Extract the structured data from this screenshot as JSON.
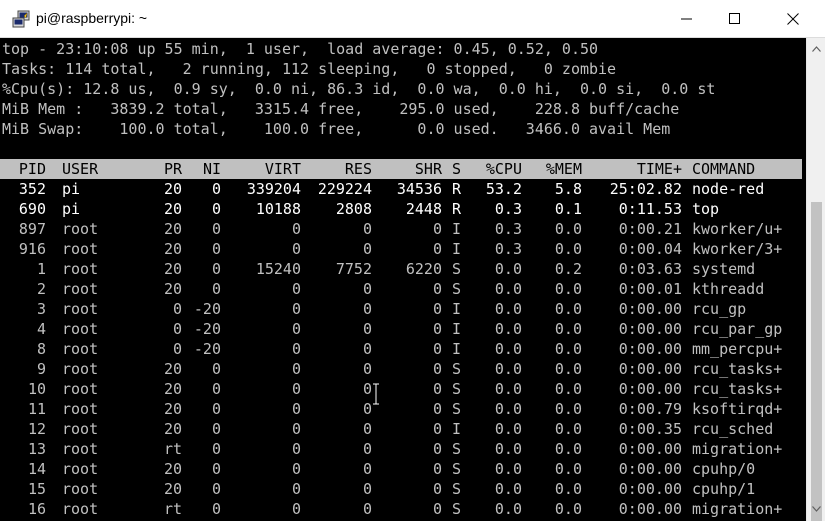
{
  "window": {
    "title": "pi@raspberrypi: ~",
    "app_icon": "putty-icon",
    "buttons": [
      "minimize-icon",
      "maximize-icon",
      "close-icon"
    ]
  },
  "summary": {
    "line1": "top - 23:10:08 up 55 min,  1 user,  load average: 0.45, 0.52, 0.50",
    "line2": "Tasks: 114 total,   2 running, 112 sleeping,   0 stopped,   0 zombie",
    "line3": "%Cpu(s): 12.8 us,  0.9 sy,  0.0 ni, 86.3 id,  0.0 wa,  0.0 hi,  0.0 si,  0.0 st",
    "line4": "MiB Mem :   3839.2 total,   3315.4 free,    295.0 used,    228.8 buff/cache",
    "line5": "MiB Swap:    100.0 total,    100.0 free,      0.0 used.   3466.0 avail Mem"
  },
  "columns": {
    "pid": "PID",
    "user": "USER",
    "pr": "PR",
    "ni": "NI",
    "virt": "VIRT",
    "res": "RES",
    "shr": "SHR",
    "s": "S",
    "cpu": "%CPU",
    "mem": "%MEM",
    "time": "TIME+",
    "command": "COMMAND"
  },
  "processes": [
    {
      "pid": "352",
      "user": "pi",
      "pr": "20",
      "ni": "0",
      "virt": "339204",
      "res": "229224",
      "shr": "34536",
      "s": "R",
      "cpu": "53.2",
      "mem": "5.8",
      "time": "25:02.82",
      "command": "node-red"
    },
    {
      "pid": "690",
      "user": "pi",
      "pr": "20",
      "ni": "0",
      "virt": "10188",
      "res": "2808",
      "shr": "2448",
      "s": "R",
      "cpu": "0.3",
      "mem": "0.1",
      "time": "0:11.53",
      "command": "top"
    },
    {
      "pid": "897",
      "user": "root",
      "pr": "20",
      "ni": "0",
      "virt": "0",
      "res": "0",
      "shr": "0",
      "s": "I",
      "cpu": "0.3",
      "mem": "0.0",
      "time": "0:00.21",
      "command": "kworker/u+"
    },
    {
      "pid": "916",
      "user": "root",
      "pr": "20",
      "ni": "0",
      "virt": "0",
      "res": "0",
      "shr": "0",
      "s": "I",
      "cpu": "0.3",
      "mem": "0.0",
      "time": "0:00.04",
      "command": "kworker/3+"
    },
    {
      "pid": "1",
      "user": "root",
      "pr": "20",
      "ni": "0",
      "virt": "15240",
      "res": "7752",
      "shr": "6220",
      "s": "S",
      "cpu": "0.0",
      "mem": "0.2",
      "time": "0:03.63",
      "command": "systemd"
    },
    {
      "pid": "2",
      "user": "root",
      "pr": "20",
      "ni": "0",
      "virt": "0",
      "res": "0",
      "shr": "0",
      "s": "S",
      "cpu": "0.0",
      "mem": "0.0",
      "time": "0:00.01",
      "command": "kthreadd"
    },
    {
      "pid": "3",
      "user": "root",
      "pr": "0",
      "ni": "-20",
      "virt": "0",
      "res": "0",
      "shr": "0",
      "s": "I",
      "cpu": "0.0",
      "mem": "0.0",
      "time": "0:00.00",
      "command": "rcu_gp"
    },
    {
      "pid": "4",
      "user": "root",
      "pr": "0",
      "ni": "-20",
      "virt": "0",
      "res": "0",
      "shr": "0",
      "s": "I",
      "cpu": "0.0",
      "mem": "0.0",
      "time": "0:00.00",
      "command": "rcu_par_gp"
    },
    {
      "pid": "8",
      "user": "root",
      "pr": "0",
      "ni": "-20",
      "virt": "0",
      "res": "0",
      "shr": "0",
      "s": "I",
      "cpu": "0.0",
      "mem": "0.0",
      "time": "0:00.00",
      "command": "mm_percpu+"
    },
    {
      "pid": "9",
      "user": "root",
      "pr": "20",
      "ni": "0",
      "virt": "0",
      "res": "0",
      "shr": "0",
      "s": "S",
      "cpu": "0.0",
      "mem": "0.0",
      "time": "0:00.00",
      "command": "rcu_tasks+"
    },
    {
      "pid": "10",
      "user": "root",
      "pr": "20",
      "ni": "0",
      "virt": "0",
      "res": "0",
      "shr": "0",
      "s": "S",
      "cpu": "0.0",
      "mem": "0.0",
      "time": "0:00.00",
      "command": "rcu_tasks+"
    },
    {
      "pid": "11",
      "user": "root",
      "pr": "20",
      "ni": "0",
      "virt": "0",
      "res": "0",
      "shr": "0",
      "s": "S",
      "cpu": "0.0",
      "mem": "0.0",
      "time": "0:00.79",
      "command": "ksoftirqd+"
    },
    {
      "pid": "12",
      "user": "root",
      "pr": "20",
      "ni": "0",
      "virt": "0",
      "res": "0",
      "shr": "0",
      "s": "I",
      "cpu": "0.0",
      "mem": "0.0",
      "time": "0:00.35",
      "command": "rcu_sched"
    },
    {
      "pid": "13",
      "user": "root",
      "pr": "rt",
      "ni": "0",
      "virt": "0",
      "res": "0",
      "shr": "0",
      "s": "S",
      "cpu": "0.0",
      "mem": "0.0",
      "time": "0:00.00",
      "command": "migration+"
    },
    {
      "pid": "14",
      "user": "root",
      "pr": "20",
      "ni": "0",
      "virt": "0",
      "res": "0",
      "shr": "0",
      "s": "S",
      "cpu": "0.0",
      "mem": "0.0",
      "time": "0:00.00",
      "command": "cpuhp/0"
    },
    {
      "pid": "15",
      "user": "root",
      "pr": "20",
      "ni": "0",
      "virt": "0",
      "res": "0",
      "shr": "0",
      "s": "S",
      "cpu": "0.0",
      "mem": "0.0",
      "time": "0:00.00",
      "command": "cpuhp/1"
    },
    {
      "pid": "16",
      "user": "root",
      "pr": "rt",
      "ni": "0",
      "virt": "0",
      "res": "0",
      "shr": "0",
      "s": "S",
      "cpu": "0.0",
      "mem": "0.0",
      "time": "0:00.00",
      "command": "migration+"
    }
  ],
  "colors": {
    "terminal_bg": "#000000",
    "terminal_fg": "#c0c0c0",
    "running_fg": "#ffffff",
    "header_bg": "#c0c0c0",
    "header_fg": "#000000"
  }
}
